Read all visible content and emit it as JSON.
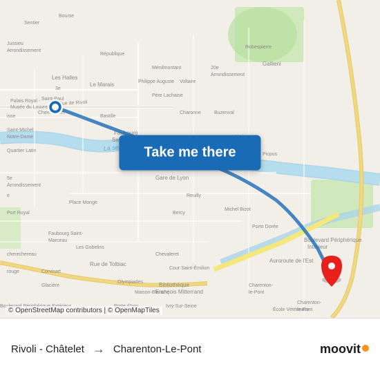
{
  "map": {
    "attribution": "© OpenStreetMap contributors | © OpenMapTiles",
    "button_label": "Take me there",
    "origin_marker_color": "#1a6bb5",
    "destination_marker_color": "#e8201a"
  },
  "route": {
    "origin": "Rivoli - Châtelet",
    "destination": "Charenton-Le-Pont",
    "arrow": "→"
  },
  "branding": {
    "name": "moovit"
  }
}
